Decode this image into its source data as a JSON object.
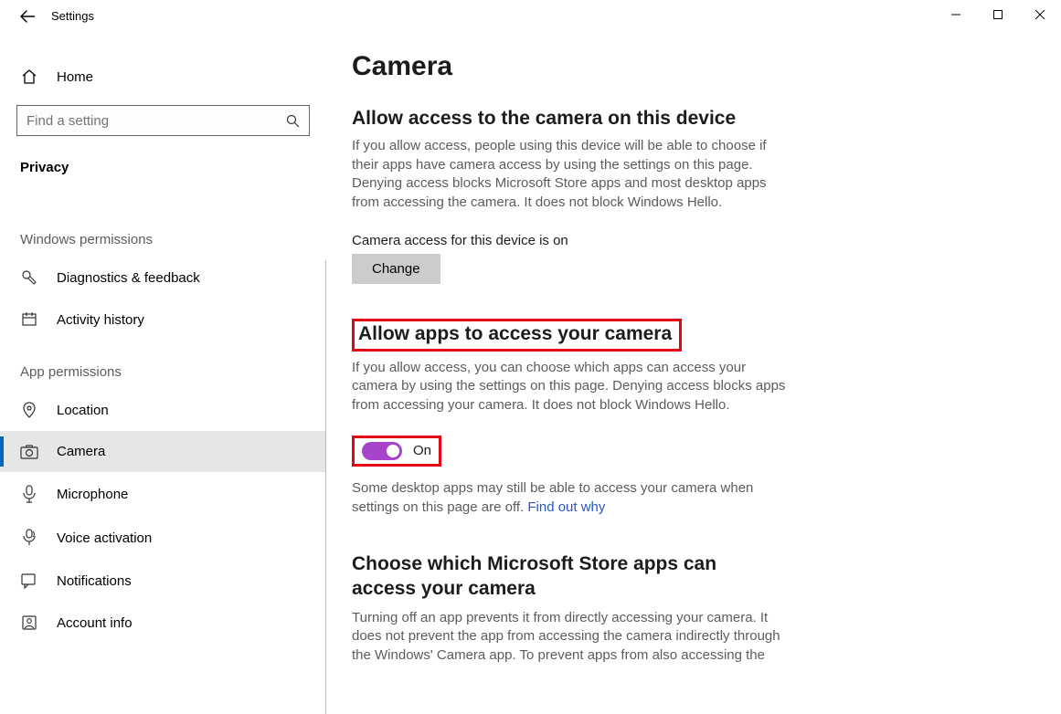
{
  "window": {
    "app_title": "Settings"
  },
  "sidebar": {
    "home_label": "Home",
    "search_placeholder": "Find a setting",
    "section_active": "Privacy",
    "group_windows": "Windows permissions",
    "group_app": "App permissions",
    "items": {
      "diagnostics": "Diagnostics & feedback",
      "activity": "Activity history",
      "location": "Location",
      "camera": "Camera",
      "microphone": "Microphone",
      "voice": "Voice activation",
      "notifications": "Notifications",
      "account": "Account info"
    }
  },
  "main": {
    "title": "Camera",
    "s1": {
      "title": "Allow access to the camera on this device",
      "desc": "If you allow access, people using this device will be able to choose if their apps have camera access by using the settings on this page. Denying access blocks Microsoft Store apps and most desktop apps from accessing the camera. It does not block Windows Hello.",
      "status": "Camera access for this device is on",
      "change_btn": "Change"
    },
    "s2": {
      "title": "Allow apps to access your camera",
      "desc": "If you allow access, you can choose which apps can access your camera by using the settings on this page. Denying access blocks apps from accessing your camera. It does not block Windows Hello.",
      "toggle_state": "On",
      "note_a": "Some desktop apps may still be able to access your camera when settings on this page are off. ",
      "note_link": "Find out why"
    },
    "s3": {
      "title": "Choose which Microsoft Store apps can access your camera",
      "desc": "Turning off an app prevents it from directly accessing your camera. It does not prevent the app from accessing the camera indirectly through the Windows' Camera app. To prevent apps from also accessing the"
    }
  }
}
